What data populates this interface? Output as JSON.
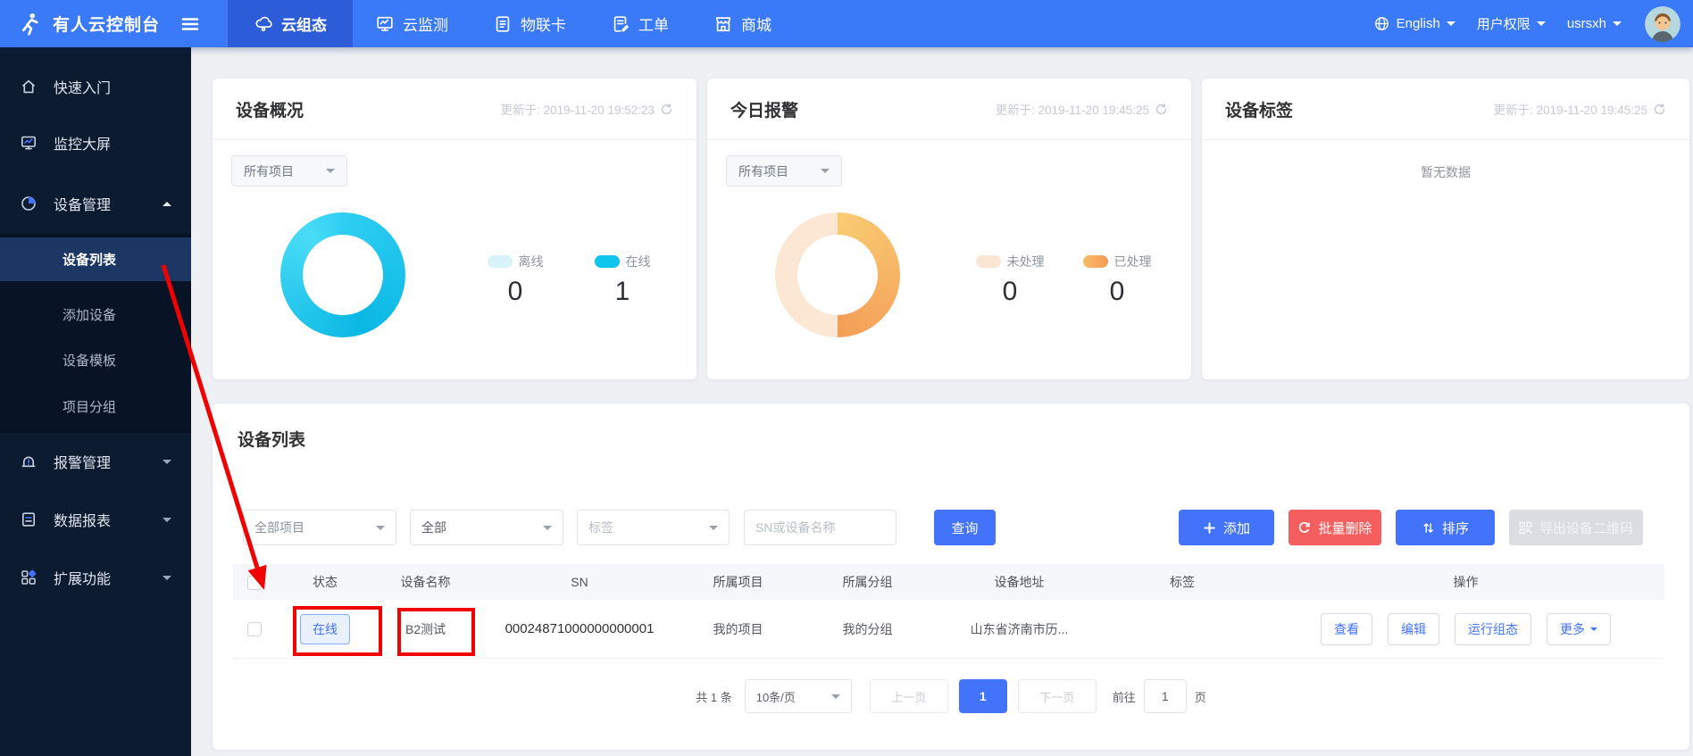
{
  "navbar": {
    "brand": "有人云控制台",
    "tabs": [
      {
        "label": "云组态",
        "icon": "cloud-icon",
        "active": true
      },
      {
        "label": "云监测",
        "icon": "monitor-icon",
        "active": false
      },
      {
        "label": "物联卡",
        "icon": "sim-card-icon",
        "active": false
      },
      {
        "label": "工单",
        "icon": "work-order-icon",
        "active": false
      },
      {
        "label": "商城",
        "icon": "store-icon",
        "active": false
      }
    ],
    "language": "English",
    "permission_menu": "用户权限",
    "username": "usrsxh"
  },
  "sidebar": {
    "items": [
      {
        "label": "快速入门"
      },
      {
        "label": "监控大屏"
      },
      {
        "label": "设备管理",
        "expanded": true,
        "children": [
          {
            "label": "设备列表",
            "active": true
          },
          {
            "label": "添加设备"
          },
          {
            "label": "设备模板"
          },
          {
            "label": "项目分组"
          }
        ]
      },
      {
        "label": "报警管理"
      },
      {
        "label": "数据报表"
      },
      {
        "label": "扩展功能"
      }
    ]
  },
  "cards": {
    "device_overview": {
      "title": "设备概况",
      "updated": "更新于: 2019-11-20 19:52:23",
      "filter": "所有项目",
      "legend": [
        {
          "label": "离线",
          "value": "0",
          "color": "#d9f3fb"
        },
        {
          "label": "在线",
          "value": "1",
          "color": "#0fc5ec"
        }
      ]
    },
    "today_alarm": {
      "title": "今日报警",
      "updated": "更新于: 2019-11-20 19:45:25",
      "filter": "所有项目",
      "legend": [
        {
          "label": "未处理",
          "value": "0",
          "color": "#fbe6d3"
        },
        {
          "label": "已处理",
          "value": "0",
          "color": "#f6a95f"
        }
      ]
    },
    "device_tags": {
      "title": "设备标签",
      "updated": "更新于: 2019-11-20 19:45:25",
      "empty_text": "暂无数据"
    }
  },
  "device_list": {
    "title": "设备列表",
    "filters": {
      "project": "全部项目",
      "status": "全部",
      "tag": "标签",
      "search_placeholder": "SN或设备名称",
      "search_button": "查询"
    },
    "toolbar": {
      "add": "添加",
      "batch_delete": "批量删除",
      "sort": "排序",
      "export_qr": "导出设备二维码"
    },
    "table": {
      "columns": [
        "状态",
        "设备名称",
        "SN",
        "所属项目",
        "所属分组",
        "设备地址",
        "标签",
        "操作"
      ],
      "rows": [
        {
          "status": "在线",
          "name": "B2测试",
          "sn": "00024871000000000001",
          "project": "我的项目",
          "group": "我的分组",
          "address": "山东省济南市历...",
          "tag": "",
          "actions": [
            "查看",
            "编辑",
            "运行组态",
            "更多"
          ]
        }
      ]
    },
    "pagination": {
      "total": "共 1 条",
      "page_size": "10条/页",
      "prev": "上一页",
      "current": "1",
      "next": "下一页",
      "goto_prefix": "前往",
      "goto_page": "1",
      "goto_suffix": "页"
    }
  },
  "colors": {
    "navbar": "#3a79f8",
    "navbar_active_tab": "#2c5cd8",
    "accent_blue": "#4273fa",
    "danger_red": "#f55e5e",
    "disabled_gray": "#dadde2",
    "annotation_red": "#ee0202",
    "online_cyan": "#0fc5ec",
    "alarm_orange": "#f6a95f",
    "sidebar_bg": "#0d1b31"
  }
}
